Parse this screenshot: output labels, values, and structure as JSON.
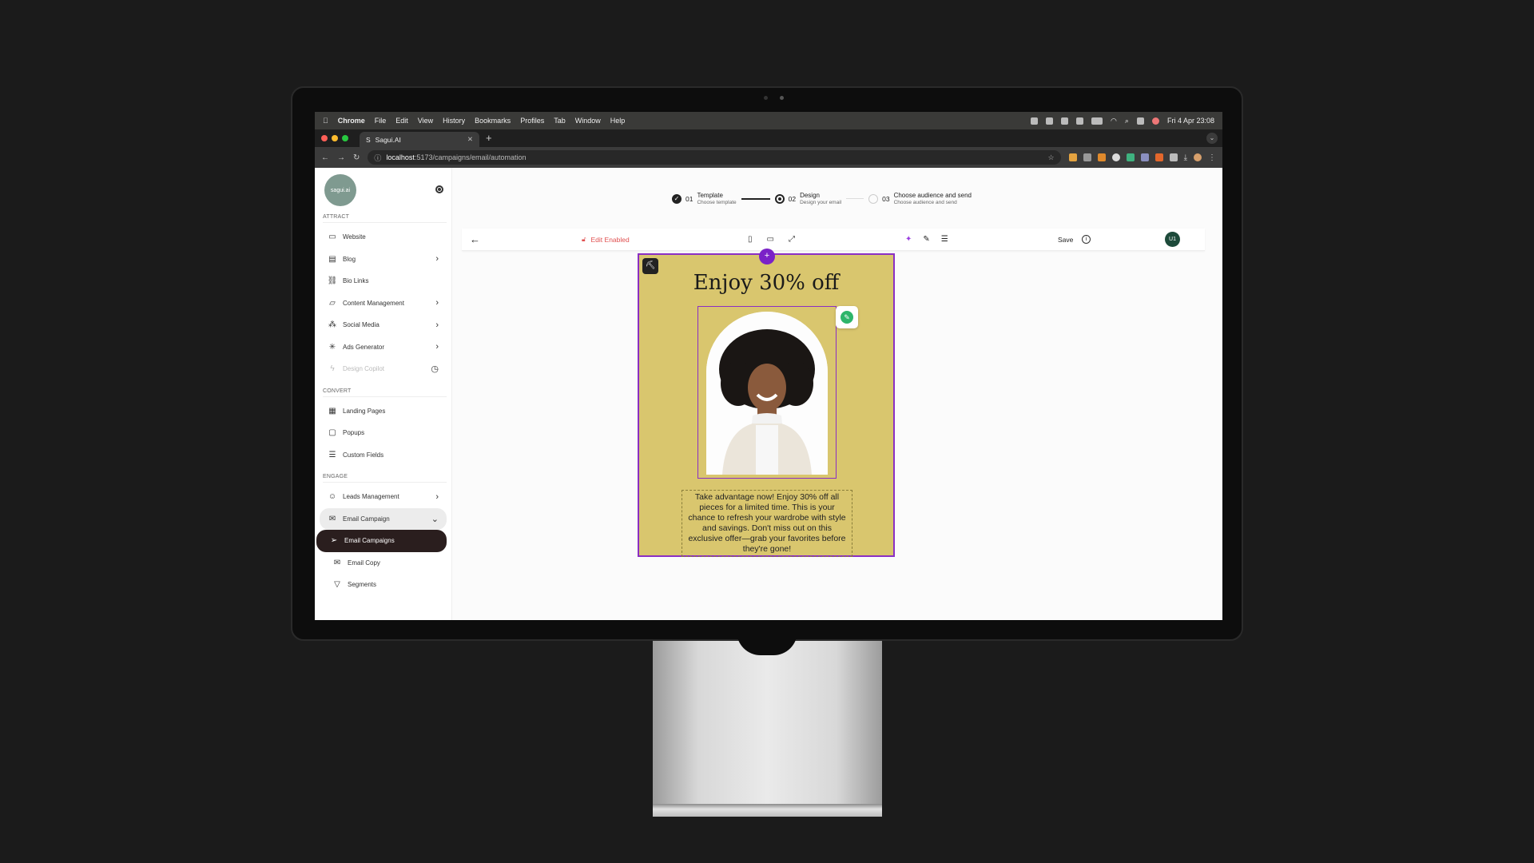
{
  "menubar": {
    "apple": "",
    "app": "Chrome",
    "items": [
      "File",
      "Edit",
      "View",
      "History",
      "Bookmarks",
      "Profiles",
      "Tab",
      "Window",
      "Help"
    ],
    "datetime": "Fri 4 Apr 23:08"
  },
  "browser": {
    "tab_title": "Sagui.AI",
    "tab_favicon": "S",
    "url_host": "localhost",
    "url_path": ":5173/campaigns/email/automation"
  },
  "sidebar": {
    "logo_text": "sagui.ai",
    "sections": {
      "attract": "ATTRACT",
      "convert": "CONVERT",
      "engage": "ENGAGE"
    },
    "attract_items": [
      {
        "label": "Website"
      },
      {
        "label": "Blog"
      },
      {
        "label": "Bio Links"
      },
      {
        "label": "Content Management"
      },
      {
        "label": "Social Media"
      },
      {
        "label": "Ads Generator"
      },
      {
        "label": "Design Copilot"
      }
    ],
    "convert_items": [
      {
        "label": "Landing Pages"
      },
      {
        "label": "Popups"
      },
      {
        "label": "Custom Fields"
      }
    ],
    "engage_items": [
      {
        "label": "Leads Management"
      },
      {
        "label": "Email Campaign"
      },
      {
        "label": "Email Campaigns"
      },
      {
        "label": "Email Copy"
      },
      {
        "label": "Segments"
      }
    ]
  },
  "stepper": {
    "steps": [
      {
        "num": "01",
        "title": "Template",
        "sub": "Choose template",
        "state": "done"
      },
      {
        "num": "02",
        "title": "Design",
        "sub": "Design your email",
        "state": "current"
      },
      {
        "num": "03",
        "title": "Choose audience and send",
        "sub": "Choose audience and send",
        "state": "pending"
      }
    ]
  },
  "toolbar": {
    "edit_status": "Edit Enabled",
    "save_label": "Save",
    "user_initials": "U1"
  },
  "email": {
    "headline": "Enjoy 30% off",
    "body": "Take advantage now! Enjoy 30% off all pieces for a limited time. This is your chance to refresh your wardrobe with style and savings. Don't miss out on this exclusive offer—grab your favorites before they're gone!",
    "background_color": "#d9c66e",
    "selection_color": "#8a2fc4"
  }
}
